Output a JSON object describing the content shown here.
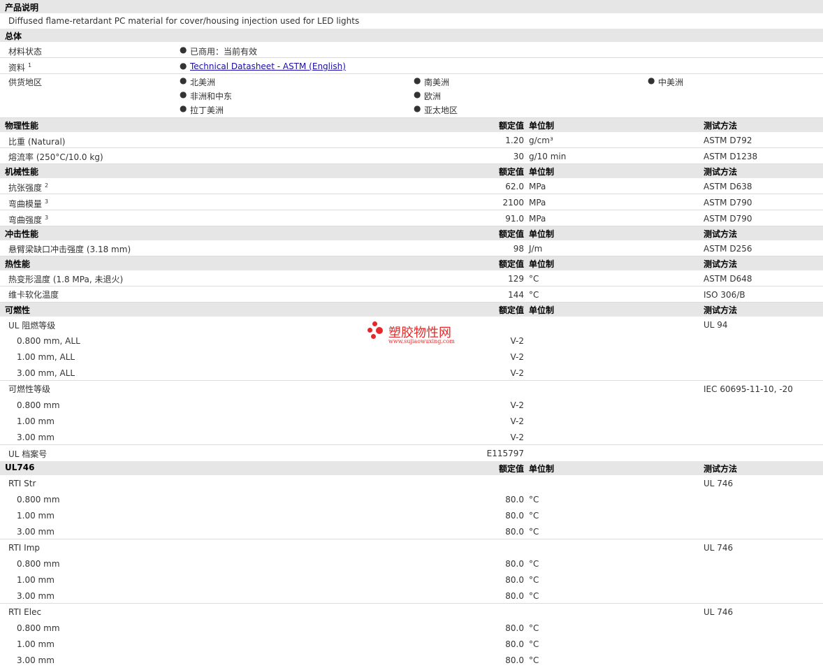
{
  "sections": {
    "product_desc": "产品说明",
    "general": "总体",
    "physical": "物理性能",
    "mechanical": "机械性能",
    "impact": "冲击性能",
    "thermal": "热性能",
    "flammability": "可燃性",
    "ul746": "UL746"
  },
  "col_headers": {
    "nominal": "额定值",
    "unit": "单位制",
    "method": "测试方法"
  },
  "description": "Diffused flame-retardant PC material for cover/housing injection used for LED lights",
  "general": {
    "status_label": "材料状态",
    "status_value": "已商用：当前有效",
    "docs_label": "资料",
    "docs_sup": "1",
    "docs_link": "Technical Datasheet - ASTM (English)",
    "supply_label": "供货地区",
    "regions": [
      "北美洲",
      "南美洲",
      "中美洲",
      "非洲和中东",
      "欧洲",
      "拉丁美洲",
      "亚太地区"
    ]
  },
  "physical": [
    {
      "name": "比重",
      "cond": "(Natural)",
      "value": "1.20",
      "unit": "g/cm³",
      "method": "ASTM D792"
    },
    {
      "name": "熔流率",
      "cond": "(250°C/10.0 kg)",
      "value": "30",
      "unit": "g/10 min",
      "method": "ASTM D1238"
    }
  ],
  "mechanical": [
    {
      "name": "抗张强度",
      "sup": "2",
      "value": "62.0",
      "unit": "MPa",
      "method": "ASTM D638"
    },
    {
      "name": "弯曲模量",
      "sup": "3",
      "value": "2100",
      "unit": "MPa",
      "method": "ASTM D790"
    },
    {
      "name": "弯曲强度",
      "sup": "3",
      "value": "91.0",
      "unit": "MPa",
      "method": "ASTM D790"
    }
  ],
  "impact": [
    {
      "name": "悬臂梁缺口冲击强度",
      "cond": "(3.18 mm)",
      "value": "98",
      "unit": "J/m",
      "method": "ASTM D256"
    }
  ],
  "thermal": [
    {
      "name": "热变形温度",
      "cond": "(1.8 MPa, 未退火)",
      "value": "129",
      "unit": "°C",
      "method": "ASTM D648"
    },
    {
      "name": "维卡软化温度",
      "cond": "",
      "value": "144",
      "unit": "°C",
      "method": "ISO 306/B"
    }
  ],
  "flammability": {
    "ul_rating_label": "UL 阻燃等级",
    "ul_rating_method": "UL 94",
    "ul_rating_rows": [
      {
        "name": "0.800 mm, ALL",
        "value": "V-2"
      },
      {
        "name": "1.00 mm, ALL",
        "value": "V-2"
      },
      {
        "name": "3.00 mm, ALL",
        "value": "V-2"
      }
    ],
    "flam_rating_label": "可燃性等级",
    "flam_rating_method": "IEC 60695-11-10, -20",
    "flam_rating_rows": [
      {
        "name": "0.800 mm",
        "value": "V-2"
      },
      {
        "name": "1.00 mm",
        "value": "V-2"
      },
      {
        "name": "3.00 mm",
        "value": "V-2"
      }
    ],
    "ul_file_label": "UL 档案号",
    "ul_file_value": "E115797"
  },
  "ul746": [
    {
      "label": "RTI Str",
      "method": "UL 746",
      "rows": [
        {
          "name": "0.800 mm",
          "value": "80.0",
          "unit": "°C"
        },
        {
          "name": "1.00 mm",
          "value": "80.0",
          "unit": "°C"
        },
        {
          "name": "3.00 mm",
          "value": "80.0",
          "unit": "°C"
        }
      ]
    },
    {
      "label": "RTI Imp",
      "method": "UL 746",
      "rows": [
        {
          "name": "0.800 mm",
          "value": "80.0",
          "unit": "°C"
        },
        {
          "name": "1.00 mm",
          "value": "80.0",
          "unit": "°C"
        },
        {
          "name": "3.00 mm",
          "value": "80.0",
          "unit": "°C"
        }
      ]
    },
    {
      "label": "RTI Elec",
      "method": "UL 746",
      "rows": [
        {
          "name": "0.800 mm",
          "value": "80.0",
          "unit": "°C"
        },
        {
          "name": "1.00 mm",
          "value": "80.0",
          "unit": "°C"
        },
        {
          "name": "3.00 mm",
          "value": "80.0",
          "unit": "°C"
        }
      ]
    }
  ],
  "watermark": {
    "title": "塑胶物性网",
    "url": "www.sujiaowuxing.com",
    "color": "#e62828"
  }
}
